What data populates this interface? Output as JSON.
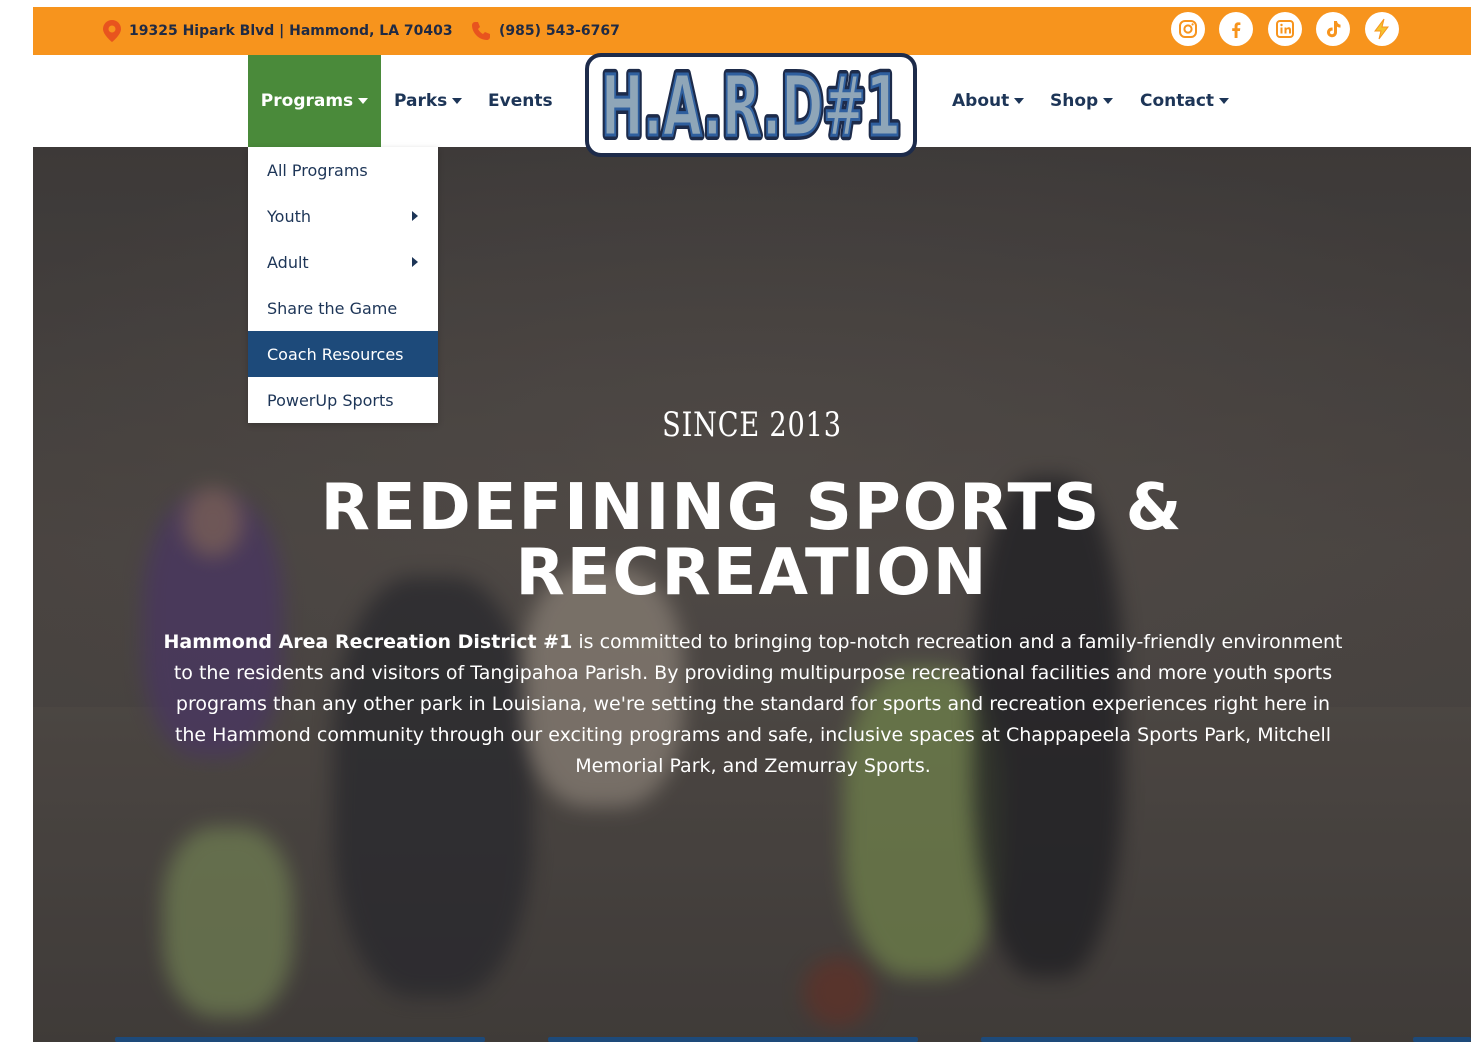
{
  "topbar": {
    "address": "19325 Hipark Blvd | Hammond, LA 70403",
    "phone": "(985) 543-6767",
    "social": [
      "instagram-icon",
      "facebook-icon",
      "linkedin-icon",
      "tiktok-icon",
      "powerup-icon"
    ]
  },
  "nav": {
    "programs": "Programs",
    "parks": "Parks",
    "events": "Events",
    "about": "About",
    "shop": "Shop",
    "contact": "Contact",
    "logo_text": "H.A.R.D#1"
  },
  "dropdown": {
    "items": [
      {
        "label": "All Programs"
      },
      {
        "label": "Youth"
      },
      {
        "label": "Adult"
      },
      {
        "label": "Share the Game"
      },
      {
        "label": "Coach Resources"
      },
      {
        "label": "PowerUp Sports"
      }
    ]
  },
  "hero": {
    "since": "SINCE 2013",
    "headline_line1": "REDEFINING SPORTS &",
    "headline_line2": "RECREATION",
    "para_bold": "Hammond Area Recreation District #1",
    "para_rest": " is committed to bringing top-notch recreation and a family-friendly environment to the residents and visitors of Tangipahoa Parish. By providing multipurpose recreational facilities and more youth sports programs than any other park in Louisiana, we're setting the standard for sports and recreation experiences right here in the Hammond community through our exciting programs and safe, inclusive spaces at Chappapeela Sports Park, Mitchell Memorial Park, and Zemurray Sports."
  },
  "colors": {
    "topbar": "#f7941d",
    "nav_active": "#4a8a3a",
    "navy": "#1d3557",
    "highlight": "#1d4a7a"
  }
}
